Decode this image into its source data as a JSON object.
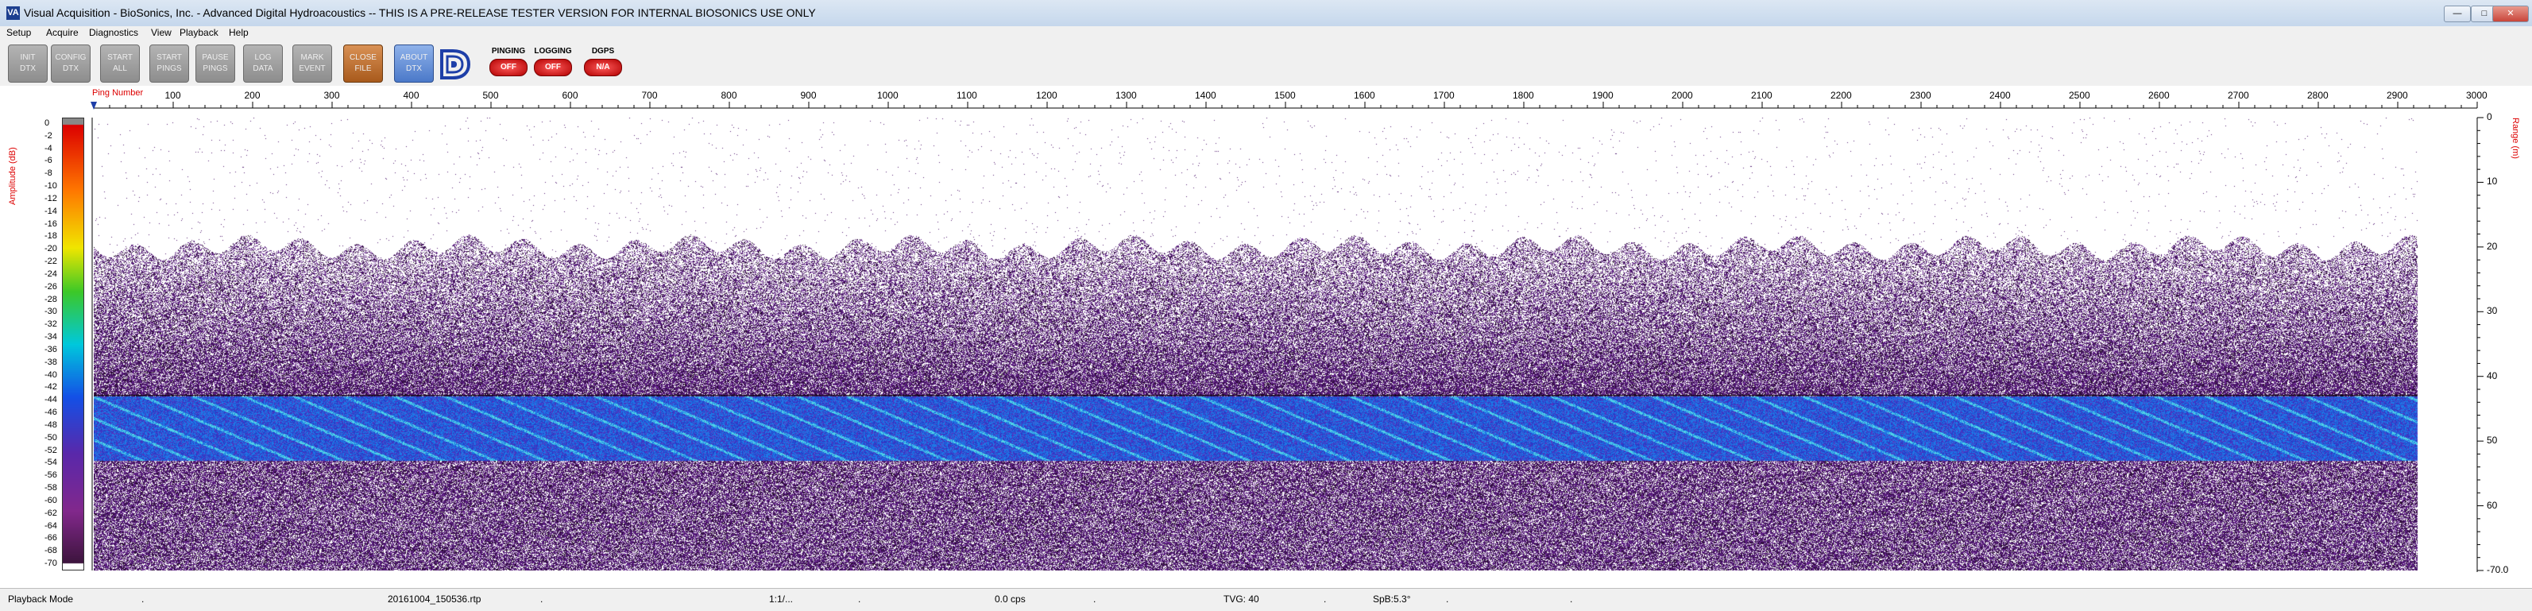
{
  "window": {
    "title": "Visual Acquisition  -  BioSonics, Inc.  -  Advanced Digital Hydroacoustics  -- THIS IS A PRE-RELEASE TESTER VERSION FOR INTERNAL BIOSONICS USE ONLY",
    "icon_text": "VA",
    "minimize": "—",
    "maximize": "□",
    "close": "✕"
  },
  "menu": [
    "Setup",
    "Acquire",
    "Diagnostics",
    "View",
    "Playback",
    "Help"
  ],
  "toolbar": {
    "buttons": [
      {
        "label": "INIT\nDTX",
        "name": "init-dtx-button"
      },
      {
        "label": "CONFIG\nDTX",
        "name": "config-dtx-button"
      },
      {
        "label": "START\nALL",
        "name": "start-all-button"
      },
      {
        "label": "START\nPINGS",
        "name": "start-pings-button"
      },
      {
        "label": "PAUSE\nPINGS",
        "name": "pause-pings-button"
      },
      {
        "label": "LOG\nDATA",
        "name": "log-data-button"
      },
      {
        "label": "MARK\nEVENT",
        "name": "mark-event-button"
      },
      {
        "label": "CLOSE\nFILE",
        "name": "close-file-button"
      },
      {
        "label": "ABOUT\nDTX",
        "name": "about-dtx-button"
      }
    ],
    "logo_icon": "biosonics-logo-icon",
    "status": [
      {
        "label": "PINGING",
        "value": "OFF"
      },
      {
        "label": "LOGGING",
        "value": "OFF"
      },
      {
        "label": "DGPS",
        "value": "N/A"
      }
    ]
  },
  "plot": {
    "ping_number_label": "Ping Number",
    "x_ticks": [
      "100",
      "200",
      "300",
      "400",
      "500",
      "600",
      "700",
      "800",
      "900",
      "1000",
      "1100",
      "1200",
      "1300",
      "1400",
      "1500",
      "1600",
      "1700",
      "1800",
      "1900",
      "2000",
      "2100",
      "2200",
      "2300",
      "2400",
      "2500",
      "2600",
      "2700",
      "2800",
      "2900",
      "3000"
    ],
    "range_label": "Range (m)",
    "range_ticks": [
      "0",
      "10",
      "20",
      "30",
      "40",
      "50",
      "60",
      "-70.0"
    ],
    "amplitude_label": "Amplitude (dB)",
    "amplitude_ticks": [
      "0",
      "-2",
      "-4",
      "-6",
      "-8",
      "-10",
      "-12",
      "-14",
      "-16",
      "-18",
      "-20",
      "-22",
      "-24",
      "-26",
      "-28",
      "-30",
      "-32",
      "-34",
      "-36",
      "-38",
      "-40",
      "-42",
      "-44",
      "-46",
      "-48",
      "-50",
      "-52",
      "-54",
      "-56",
      "-58",
      "-60",
      "-62",
      "-64",
      "-66",
      "-68",
      "-70"
    ],
    "colors": {
      "noise": "#4b1c6f",
      "band": "#1f7be0",
      "band_highlight": "#35d0e8",
      "label_red": "#dd0000"
    },
    "echo": {
      "last_ping": 2925,
      "noise_top_m": 20,
      "band_top_m": 43,
      "band_bottom_m": 53,
      "max_range_m": 70
    }
  },
  "statusbar": {
    "mode": "Playback Mode",
    "file": "20161004_150536.rtp",
    "ratio": "1:1/...",
    "rate": "0.0 cps",
    "tvg": "TVG: 40",
    "spb": "SpB:5.3°",
    "dots": [
      ".",
      " .",
      ".",
      ".",
      ".",
      ".",
      "."
    ]
  }
}
